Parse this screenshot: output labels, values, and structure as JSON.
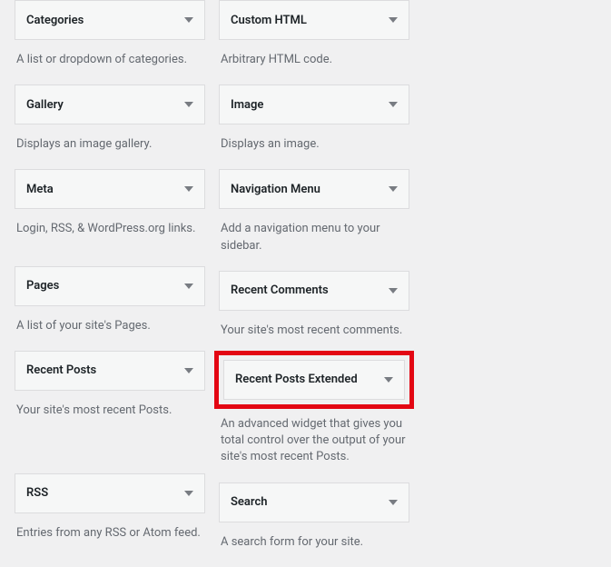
{
  "widgets": {
    "left": [
      {
        "title": "Categories",
        "description": "A list or dropdown of categories."
      },
      {
        "title": "Gallery",
        "description": "Displays an image gallery."
      },
      {
        "title": "Meta",
        "description": "Login, RSS, & WordPress.org links."
      },
      {
        "title": "Pages",
        "description": "A list of your site's Pages."
      },
      {
        "title": "Recent Posts",
        "description": "Your site's most recent Posts."
      },
      {
        "title": "RSS",
        "description": "Entries from any RSS or Atom feed."
      }
    ],
    "right": [
      {
        "title": "Custom HTML",
        "description": "Arbitrary HTML code."
      },
      {
        "title": "Image",
        "description": "Displays an image."
      },
      {
        "title": "Navigation Menu",
        "description": "Add a navigation menu to your sidebar."
      },
      {
        "title": "Recent Comments",
        "description": "Your site's most recent comments."
      },
      {
        "title": "Recent Posts Extended",
        "description": "An advanced widget that gives you total control over the output of your site's most recent Posts.",
        "highlighted": true
      },
      {
        "title": "Search",
        "description": "A search form for your site."
      }
    ]
  }
}
